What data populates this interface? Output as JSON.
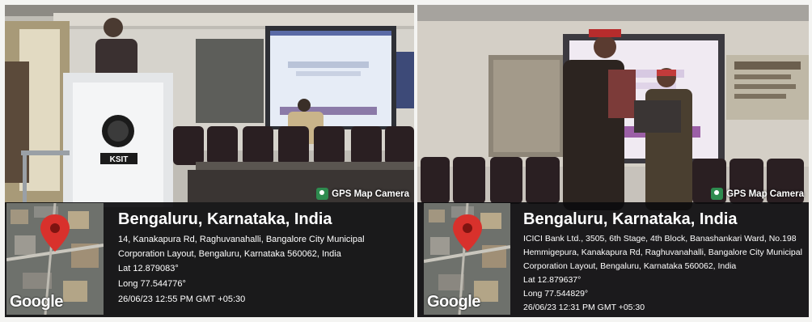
{
  "photos": [
    {
      "watermark": "GPS Map Camera",
      "podium_logo": "KSIT",
      "map_brand": "Google",
      "city": "Bengaluru, Karnataka, India",
      "address": "14, Kanakapura Rd, Raghuvanahalli, Bangalore City Municipal Corporation Layout, Bengaluru, Karnataka 560062, India",
      "lat": "Lat 12.879083°",
      "long": "Long 77.544776°",
      "datetime": "26/06/23 12:55 PM GMT +05:30"
    },
    {
      "watermark": "GPS Map Camera",
      "map_brand": "Google",
      "city": "Bengaluru, Karnataka, India",
      "address": "ICICI Bank Ltd., 3505, 6th Stage, 4th Block, Banashankari Ward, No.198 Hemmigepura, Kanakapura Rd, Raghuvanahalli, Bangalore City Municipal Corporation Layout, Bengaluru, Karnataka 560062, India",
      "lat": "Lat 12.879637°",
      "long": "Long 77.544829°",
      "datetime": "26/06/23 12:31 PM GMT +05:30"
    }
  ],
  "colors": {
    "overlay": "#0c0c0e",
    "pin": "#d8312c",
    "gps_icon": "#2e8b4f"
  }
}
